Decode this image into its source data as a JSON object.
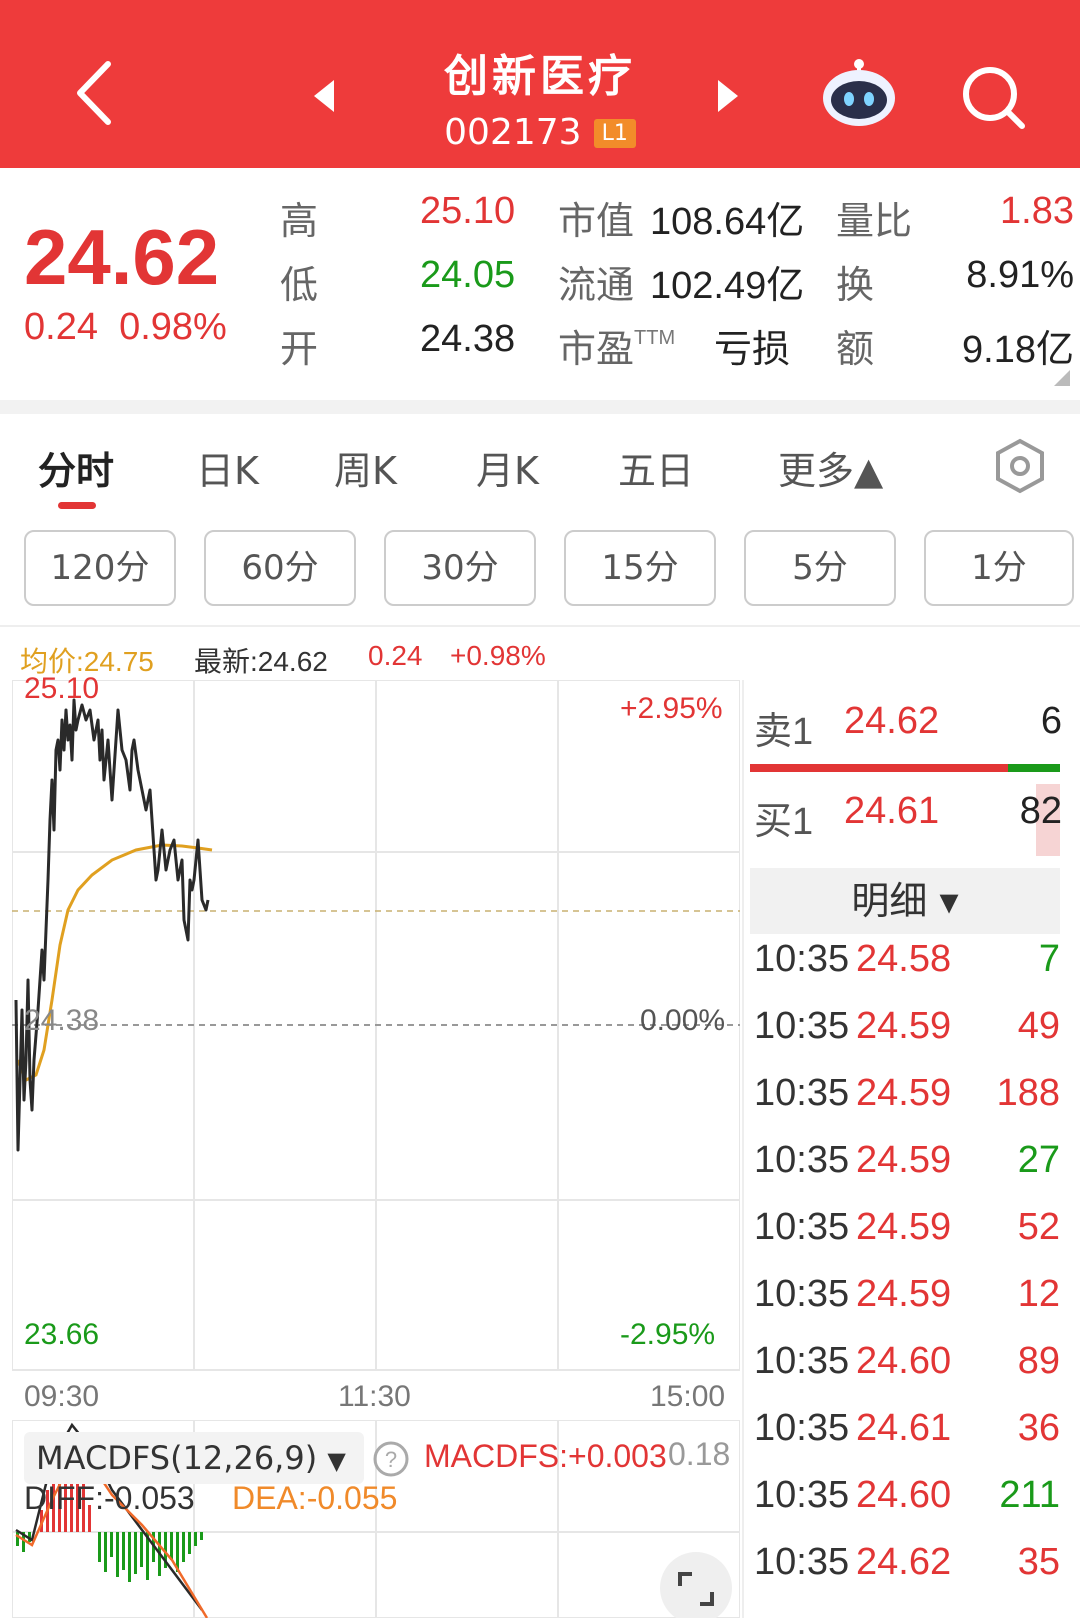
{
  "header": {
    "title": "创新医疗",
    "code": "002173",
    "badge": "L1",
    "icons": [
      "back-icon",
      "prev-stock-icon",
      "next-stock-icon",
      "robot-assistant-icon",
      "search-icon"
    ]
  },
  "quote": {
    "price": "24.62",
    "change": "0.24",
    "change_pct": "0.98%",
    "high_label": "高",
    "high": "25.10",
    "low_label": "低",
    "low": "24.05",
    "open_label": "开",
    "open": "24.38",
    "mktcap_label": "市值",
    "mktcap": "108.64亿",
    "float_label": "流通",
    "float": "102.49亿",
    "pe_label": "市盈",
    "pe_sup": "TTM",
    "pe": "亏损",
    "volratio_label": "量比",
    "volratio": "1.83",
    "turnover_label": "换",
    "turnover": "8.91%",
    "amount_label": "额",
    "amount": "9.18亿"
  },
  "tabs": [
    "分时",
    "日K",
    "周K",
    "月K",
    "五日",
    "更多▲"
  ],
  "periods": [
    "120分",
    "60分",
    "30分",
    "15分",
    "5分",
    "1分"
  ],
  "chart_info": {
    "avg": "均价:24.75",
    "latest": "最新:24.62",
    "change": "0.24",
    "change_pct": "+0.98%"
  },
  "chart_labels": {
    "top_left": "25.10",
    "mid_left": "24.38",
    "bottom_left": "23.66",
    "top_right": "+2.95%",
    "mid_right": "0.00%",
    "bottom_right": "-2.95%",
    "times": [
      "09:30",
      "11:30",
      "15:00"
    ]
  },
  "macd": {
    "selector": "MACDFS(12,26,9)",
    "help_icon": "question-icon",
    "macdfs": "MACDFS:+0.003",
    "axis_top": "0.18",
    "diff": "DIFF:-0.053",
    "dea": "DEA:-0.055"
  },
  "order_book": {
    "sell_label": "卖1",
    "sell_price": "24.62",
    "sell_vol": "6",
    "buy_label": "买1",
    "buy_price": "24.61",
    "buy_vol": "82",
    "detail_label": "明细 ▾"
  },
  "ticks": [
    {
      "time": "10:35",
      "price": "24.58",
      "vol": "7",
      "dir": "green"
    },
    {
      "time": "10:35",
      "price": "24.59",
      "vol": "49",
      "dir": "red"
    },
    {
      "time": "10:35",
      "price": "24.59",
      "vol": "188",
      "dir": "red"
    },
    {
      "time": "10:35",
      "price": "24.59",
      "vol": "27",
      "dir": "green"
    },
    {
      "time": "10:35",
      "price": "24.59",
      "vol": "52",
      "dir": "red"
    },
    {
      "time": "10:35",
      "price": "24.59",
      "vol": "12",
      "dir": "red"
    },
    {
      "time": "10:35",
      "price": "24.60",
      "vol": "89",
      "dir": "red"
    },
    {
      "time": "10:35",
      "price": "24.61",
      "vol": "36",
      "dir": "red"
    },
    {
      "time": "10:35",
      "price": "24.60",
      "vol": "211",
      "dir": "green"
    },
    {
      "time": "10:35",
      "price": "24.62",
      "vol": "35",
      "dir": "red"
    }
  ],
  "colors": {
    "up": "#e23535",
    "down": "#1a9a1a",
    "header": "#ee3b3b",
    "avg_line": "#e0a020"
  }
}
